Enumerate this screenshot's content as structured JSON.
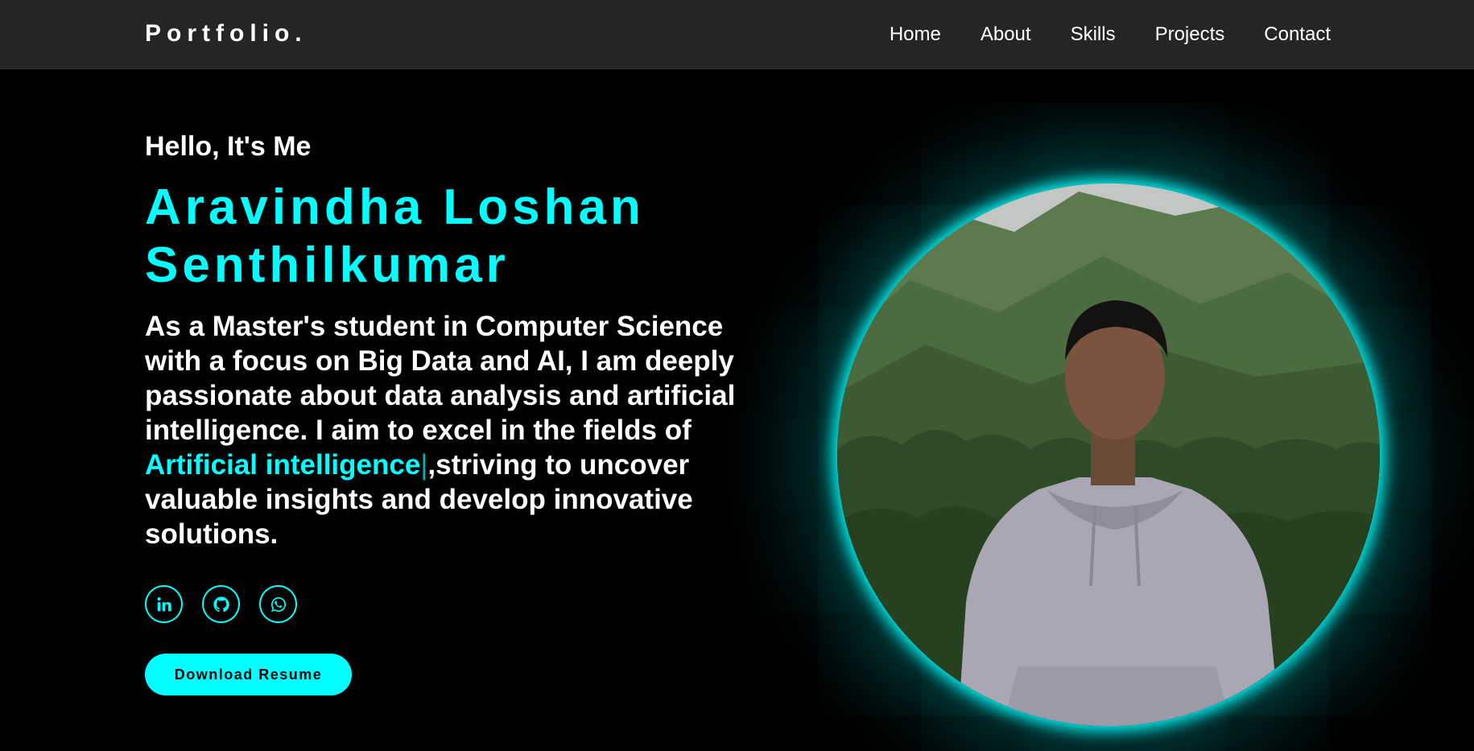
{
  "nav": {
    "logo": "Portfolio.",
    "links": [
      "Home",
      "About",
      "Skills",
      "Projects",
      "Contact"
    ]
  },
  "hero": {
    "greeting": "Hello, It's Me",
    "name_line1": "Aravindha Loshan",
    "name_line2": "Senthilkumar",
    "description_before": "As a Master's student in Computer Science with a focus on Big Data and AI, I am deeply passionate about data analysis and artificial intelligence. I aim to excel in the fields of ",
    "highlight": "Artificial intelligence",
    "cursor": "|",
    "description_after": ",striving to uncover valuable insights and develop innovative solutions.",
    "socials": [
      {
        "icon": "linkedin-icon"
      },
      {
        "icon": "github-icon"
      },
      {
        "icon": "whatsapp-icon"
      }
    ],
    "resume_label": "Download Resume"
  },
  "colors": {
    "accent": "#00ffff",
    "background": "#000000",
    "navbar": "#252525",
    "text": "#ffffff"
  }
}
